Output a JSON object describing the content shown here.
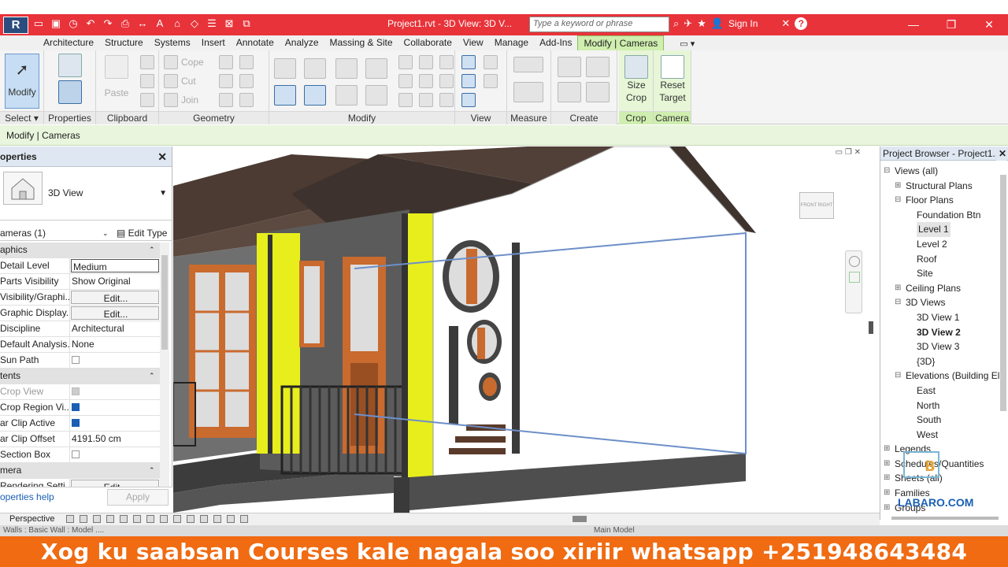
{
  "title_bar": {
    "app_logo": "R",
    "doc_title": "Project1.rvt - 3D View: 3D V...",
    "search_placeholder": "Type a keyword or phrase",
    "sign_in": "Sign In",
    "help": "?"
  },
  "ribbon_tabs": [
    "Architecture",
    "Structure",
    "Systems",
    "Insert",
    "Annotate",
    "Analyze",
    "Massing & Site",
    "Collaborate",
    "View",
    "Manage",
    "Add-Ins",
    "Modify | Cameras"
  ],
  "ribbon": {
    "select": {
      "modify_label": "Modify",
      "panel": "Select"
    },
    "properties": {
      "panel": "Properties"
    },
    "clipboard": {
      "paste": "Paste",
      "panel": "Clipboard"
    },
    "geometry": {
      "cope": "Cope",
      "cut": "Cut",
      "join": "Join",
      "panel": "Geometry"
    },
    "modify": {
      "panel": "Modify"
    },
    "view": {
      "panel": "View"
    },
    "measure": {
      "panel": "Measure"
    },
    "create": {
      "panel": "Create"
    },
    "crop": {
      "size_crop_1": "Size",
      "size_crop_2": "Crop",
      "panel": "Crop"
    },
    "camera": {
      "reset_target_1": "Reset",
      "reset_target_2": "Target",
      "panel": "Camera"
    }
  },
  "options_bar": {
    "context": "Modify | Cameras"
  },
  "properties_palette": {
    "header": "operties",
    "type_name": "3D View",
    "instance_selector": "ameras (1)",
    "edit_type": "Edit Type",
    "rows": [
      {
        "group": "aphics"
      },
      {
        "k": "Detail Level",
        "v": "Medium",
        "style": "box"
      },
      {
        "k": "Parts Visibility",
        "v": "Show Original"
      },
      {
        "k": "Visibility/Graphi...",
        "v": "Edit...",
        "style": "btn"
      },
      {
        "k": "Graphic Display...",
        "v": "Edit...",
        "style": "btn"
      },
      {
        "k": "Discipline",
        "v": "Architectural"
      },
      {
        "k": "Default Analysis...",
        "v": "None"
      },
      {
        "k": "Sun Path",
        "check": "off"
      },
      {
        "group": "tents"
      },
      {
        "k": "Crop View",
        "check": "dim",
        "dim": true
      },
      {
        "k": "Crop Region Vi...",
        "check": "on"
      },
      {
        "k": "ar Clip Active",
        "check": "on"
      },
      {
        "k": "ar Clip Offset",
        "v": "4191.50 cm"
      },
      {
        "k": "Section Box",
        "check": "off"
      },
      {
        "group": "mera"
      },
      {
        "k": "Rendering Setti...",
        "v": "Edit...",
        "style": "btn"
      }
    ],
    "help_link": "operties help",
    "apply": "Apply"
  },
  "project_browser": {
    "title": "Project Browser - Project1....",
    "tree": [
      {
        "label": "Views (all)",
        "level": 0,
        "toggle": "⊟"
      },
      {
        "label": "Structural Plans",
        "level": 1,
        "toggle": "⊞"
      },
      {
        "label": "Floor Plans",
        "level": 1,
        "toggle": "⊟"
      },
      {
        "label": "Foundation Btn",
        "level": 2
      },
      {
        "label": "Level 1",
        "level": 2,
        "hl": true
      },
      {
        "label": "Level 2",
        "level": 2
      },
      {
        "label": "Roof",
        "level": 2
      },
      {
        "label": "Site",
        "level": 2
      },
      {
        "label": "Ceiling Plans",
        "level": 1,
        "toggle": "⊞"
      },
      {
        "label": "3D Views",
        "level": 1,
        "toggle": "⊟"
      },
      {
        "label": "3D View 1",
        "level": 2
      },
      {
        "label": "3D View 2",
        "level": 2,
        "bold": true
      },
      {
        "label": "3D View 3",
        "level": 2
      },
      {
        "label": "{3D}",
        "level": 2
      },
      {
        "label": "Elevations (Building El",
        "level": 1,
        "toggle": "⊟"
      },
      {
        "label": "East",
        "level": 2
      },
      {
        "label": "North",
        "level": 2
      },
      {
        "label": "South",
        "level": 2
      },
      {
        "label": "West",
        "level": 2
      },
      {
        "label": "Legends",
        "level": 0,
        "toggle": "⊞"
      },
      {
        "label": "Schedules/Quantities",
        "level": 0,
        "toggle": "⊞"
      },
      {
        "label": "Sheets (all)",
        "level": 0,
        "toggle": "⊞"
      },
      {
        "label": "Families",
        "level": 0,
        "toggle": "⊞"
      },
      {
        "label": "Groups",
        "level": 0,
        "toggle": "⊞"
      }
    ]
  },
  "viewcube": {
    "front": "FRONT",
    "right": "RIGHT"
  },
  "view_control": {
    "mode": "Perspective"
  },
  "status_bar": {
    "left": "Walls : Basic Wall : Model ....",
    "right": "Main Model"
  },
  "watermark": "LABARO.COM",
  "banner": "Xog ku saabsan Courses kale  nagala soo xiriir whatsapp +251948643484",
  "colors": {
    "title_red": "#e8333a",
    "context_green": "#cfeeaf",
    "accent_yellow": "#e8ee1c",
    "banner_orange": "#f06b12"
  }
}
